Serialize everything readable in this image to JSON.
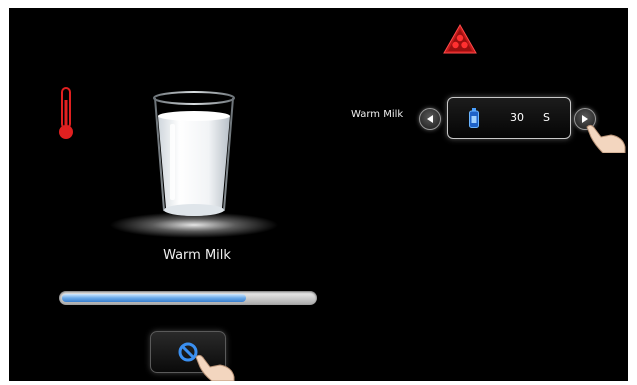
{
  "drink": {
    "name": "Warm Milk"
  },
  "progress": {
    "fraction": 0.73,
    "fill_color": "#5a9be0"
  },
  "setting": {
    "label": "Warm Milk",
    "value": "30",
    "unit": "S",
    "icon": "milk-bottle-icon"
  },
  "icons": {
    "warning": "warning-triangle-icon",
    "temperature": "thermometer-icon",
    "stop": "stop-icon",
    "decrease": "left-arrow-icon",
    "increase": "right-arrow-icon",
    "pointer": "hand-pointer-icon"
  },
  "colors": {
    "background": "#000000",
    "warning_red": "#d42020",
    "thermometer_red": "#e02020",
    "accent_blue": "#3a7fcf"
  }
}
